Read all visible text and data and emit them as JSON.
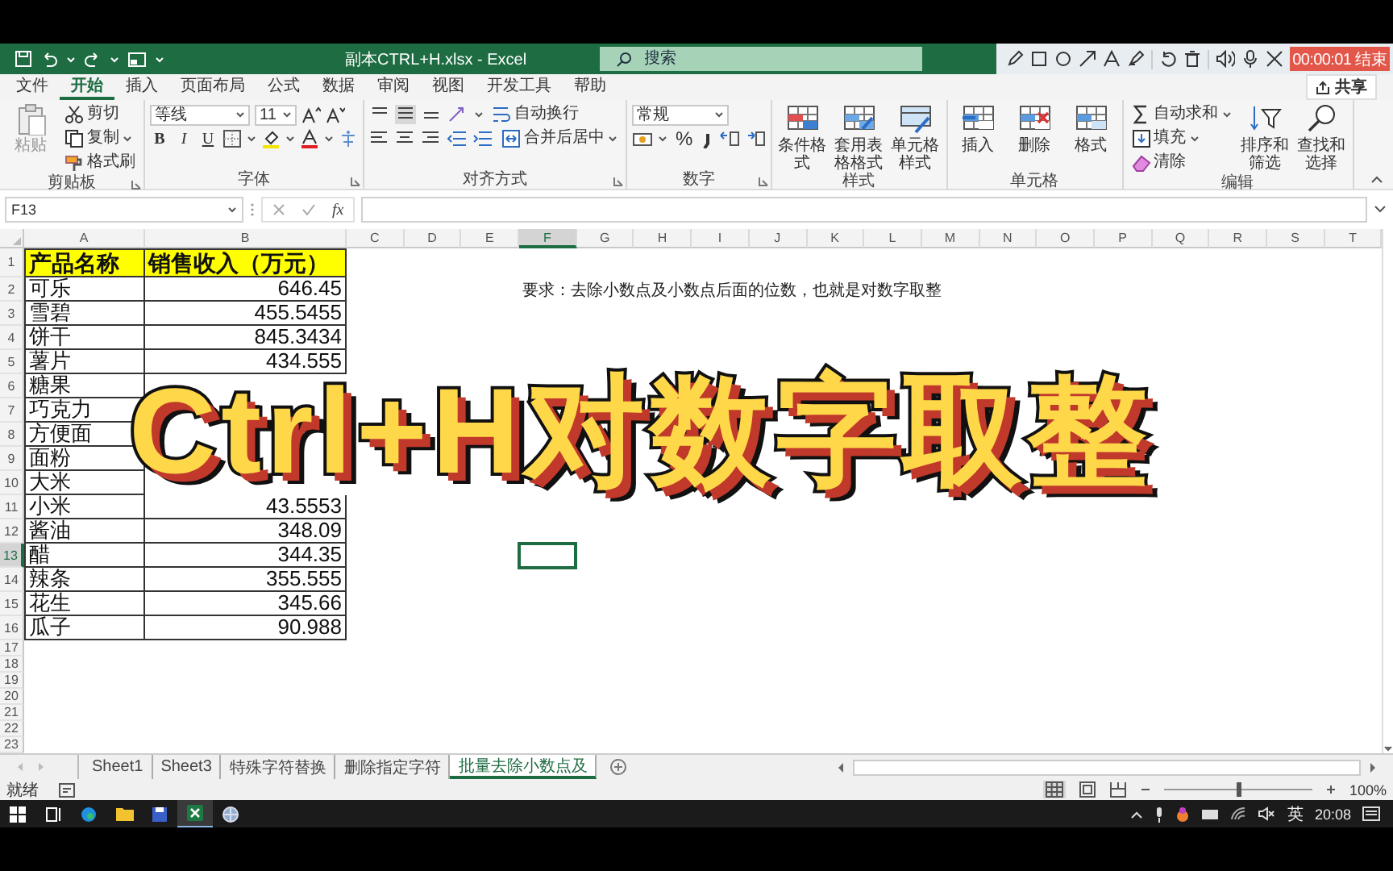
{
  "title_bar": {
    "title": "副本CTRL+H.xlsx - Excel",
    "search": {
      "placeholder": "搜索"
    }
  },
  "recording_toolbar": {
    "timer": "00:00:01 结束"
  },
  "menu_tabs": [
    {
      "label": "文件",
      "selected": false
    },
    {
      "label": "开始",
      "selected": true
    },
    {
      "label": "插入",
      "selected": false
    },
    {
      "label": "页面布局",
      "selected": false
    },
    {
      "label": "公式",
      "selected": false
    },
    {
      "label": "数据",
      "selected": false
    },
    {
      "label": "审阅",
      "selected": false
    },
    {
      "label": "视图",
      "selected": false
    },
    {
      "label": "开发工具",
      "selected": false
    },
    {
      "label": "帮助",
      "selected": false
    }
  ],
  "share_button": "共享",
  "ribbon_groups": [
    {
      "kind": "clipboard",
      "label": "剪贴板",
      "large": [
        {
          "label": "粘贴",
          "disabled": true
        }
      ],
      "small": [
        "剪切",
        "复制",
        "格式刷"
      ]
    },
    {
      "kind": "font",
      "label": "字体",
      "font_name": "等线",
      "font_size": "11",
      "styles": [
        "B",
        "I",
        "U"
      ]
    },
    {
      "kind": "alignment",
      "label": "对齐方式",
      "small": [
        "自动换行",
        "合并后居中"
      ]
    },
    {
      "kind": "number",
      "label": "数字",
      "format": "常规",
      "symbols": [
        "%"
      ]
    },
    {
      "kind": "styles",
      "label": "样式",
      "large": [
        {
          "label": "条件格式",
          "disabled": false
        },
        {
          "label": "套用表格格式",
          "disabled": false
        },
        {
          "label": "单元格样式",
          "disabled": false
        }
      ]
    },
    {
      "kind": "cells",
      "label": "单元格",
      "large": [
        {
          "label": "插入",
          "disabled": false
        },
        {
          "label": "删除",
          "disabled": false
        },
        {
          "label": "格式",
          "disabled": false
        }
      ]
    },
    {
      "kind": "editing",
      "label": "编辑",
      "small": [
        "自动求和",
        "填充",
        "清除"
      ],
      "large": [
        {
          "label": "排序和筛选",
          "disabled": false
        },
        {
          "label": "查找和选择",
          "disabled": false
        }
      ]
    }
  ],
  "formula_bar": {
    "name_box": "F13",
    "function_label": "fx"
  },
  "sheet": {
    "columns": [
      {
        "label": "A",
        "selected": false
      },
      {
        "label": "B",
        "selected": false
      },
      {
        "label": "C",
        "selected": false
      },
      {
        "label": "D",
        "selected": false
      },
      {
        "label": "E",
        "selected": false
      },
      {
        "label": "F",
        "selected": true
      },
      {
        "label": "G",
        "selected": false
      },
      {
        "label": "H",
        "selected": false
      },
      {
        "label": "I",
        "selected": false
      },
      {
        "label": "J",
        "selected": false
      },
      {
        "label": "K",
        "selected": false
      },
      {
        "label": "L",
        "selected": false
      },
      {
        "label": "M",
        "selected": false
      },
      {
        "label": "N",
        "selected": false
      },
      {
        "label": "O",
        "selected": false
      },
      {
        "label": "P",
        "selected": false
      },
      {
        "label": "Q",
        "selected": false
      },
      {
        "label": "R",
        "selected": false
      },
      {
        "label": "S",
        "selected": false
      },
      {
        "label": "T",
        "selected": false
      }
    ],
    "rows": [
      {
        "label": "1",
        "selected": false,
        "kind": "header",
        "cells": [
          "产品名称",
          "销售收入（万元）"
        ]
      },
      {
        "label": "2",
        "selected": false,
        "kind": "data",
        "cells": [
          "可乐",
          "646.45"
        ]
      },
      {
        "label": "3",
        "selected": false,
        "kind": "data",
        "cells": [
          "雪碧",
          "455.5455"
        ]
      },
      {
        "label": "4",
        "selected": false,
        "kind": "data",
        "cells": [
          "饼干",
          "845.3434"
        ]
      },
      {
        "label": "5",
        "selected": false,
        "kind": "data",
        "cells": [
          "薯片",
          "434.555"
        ]
      },
      {
        "label": "6",
        "selected": false,
        "kind": "data",
        "cells": [
          "糖果"
        ]
      },
      {
        "label": "7",
        "selected": false,
        "kind": "data",
        "cells": [
          "巧克力"
        ]
      },
      {
        "label": "8",
        "selected": false,
        "kind": "data",
        "cells": [
          "方便面"
        ]
      },
      {
        "label": "9",
        "selected": false,
        "kind": "data",
        "cells": [
          "面粉"
        ]
      },
      {
        "label": "10",
        "selected": false,
        "kind": "data",
        "cells": [
          "大米"
        ]
      },
      {
        "label": "11",
        "selected": false,
        "kind": "data",
        "cells": [
          "小米",
          "43.5553"
        ]
      },
      {
        "label": "12",
        "selected": false,
        "kind": "data",
        "cells": [
          "酱油",
          "348.09"
        ]
      },
      {
        "label": "13",
        "selected": true,
        "kind": "data",
        "cells": [
          "醋",
          "344.35"
        ]
      },
      {
        "label": "14",
        "selected": false,
        "kind": "data",
        "cells": [
          "辣条",
          "355.555"
        ]
      },
      {
        "label": "15",
        "selected": false,
        "kind": "data",
        "cells": [
          "花生",
          "345.66"
        ]
      },
      {
        "label": "16",
        "selected": false,
        "kind": "data",
        "cells": [
          "瓜子",
          "90.988"
        ]
      },
      {
        "label": "17",
        "selected": false,
        "kind": "blank"
      },
      {
        "label": "18",
        "selected": false,
        "kind": "blank"
      },
      {
        "label": "19",
        "selected": false,
        "kind": "blank"
      },
      {
        "label": "20",
        "selected": false,
        "kind": "blank"
      },
      {
        "label": "21",
        "selected": false,
        "kind": "blank"
      },
      {
        "label": "22",
        "selected": false,
        "kind": "blank"
      },
      {
        "label": "23",
        "selected": false,
        "kind": "blank"
      }
    ],
    "note": "要求：去除小数点及小数点后面的位数，也就是对数字取整"
  },
  "overlay_title": "Ctrl+H对数字取整",
  "sheet_tabs": [
    {
      "label": "Sheet1",
      "selected": false
    },
    {
      "label": "Sheet3",
      "selected": false
    },
    {
      "label": "特殊字符替换",
      "selected": false
    },
    {
      "label": "删除指定字符",
      "selected": false
    },
    {
      "label": "批量去除小数点及",
      "selected": true
    }
  ],
  "status_bar": {
    "status": "就绪",
    "zoom": {
      "level": 0.5
    },
    "zoom_label": "100%"
  },
  "taskbar": {
    "ime": "英",
    "time": "20:08"
  }
}
